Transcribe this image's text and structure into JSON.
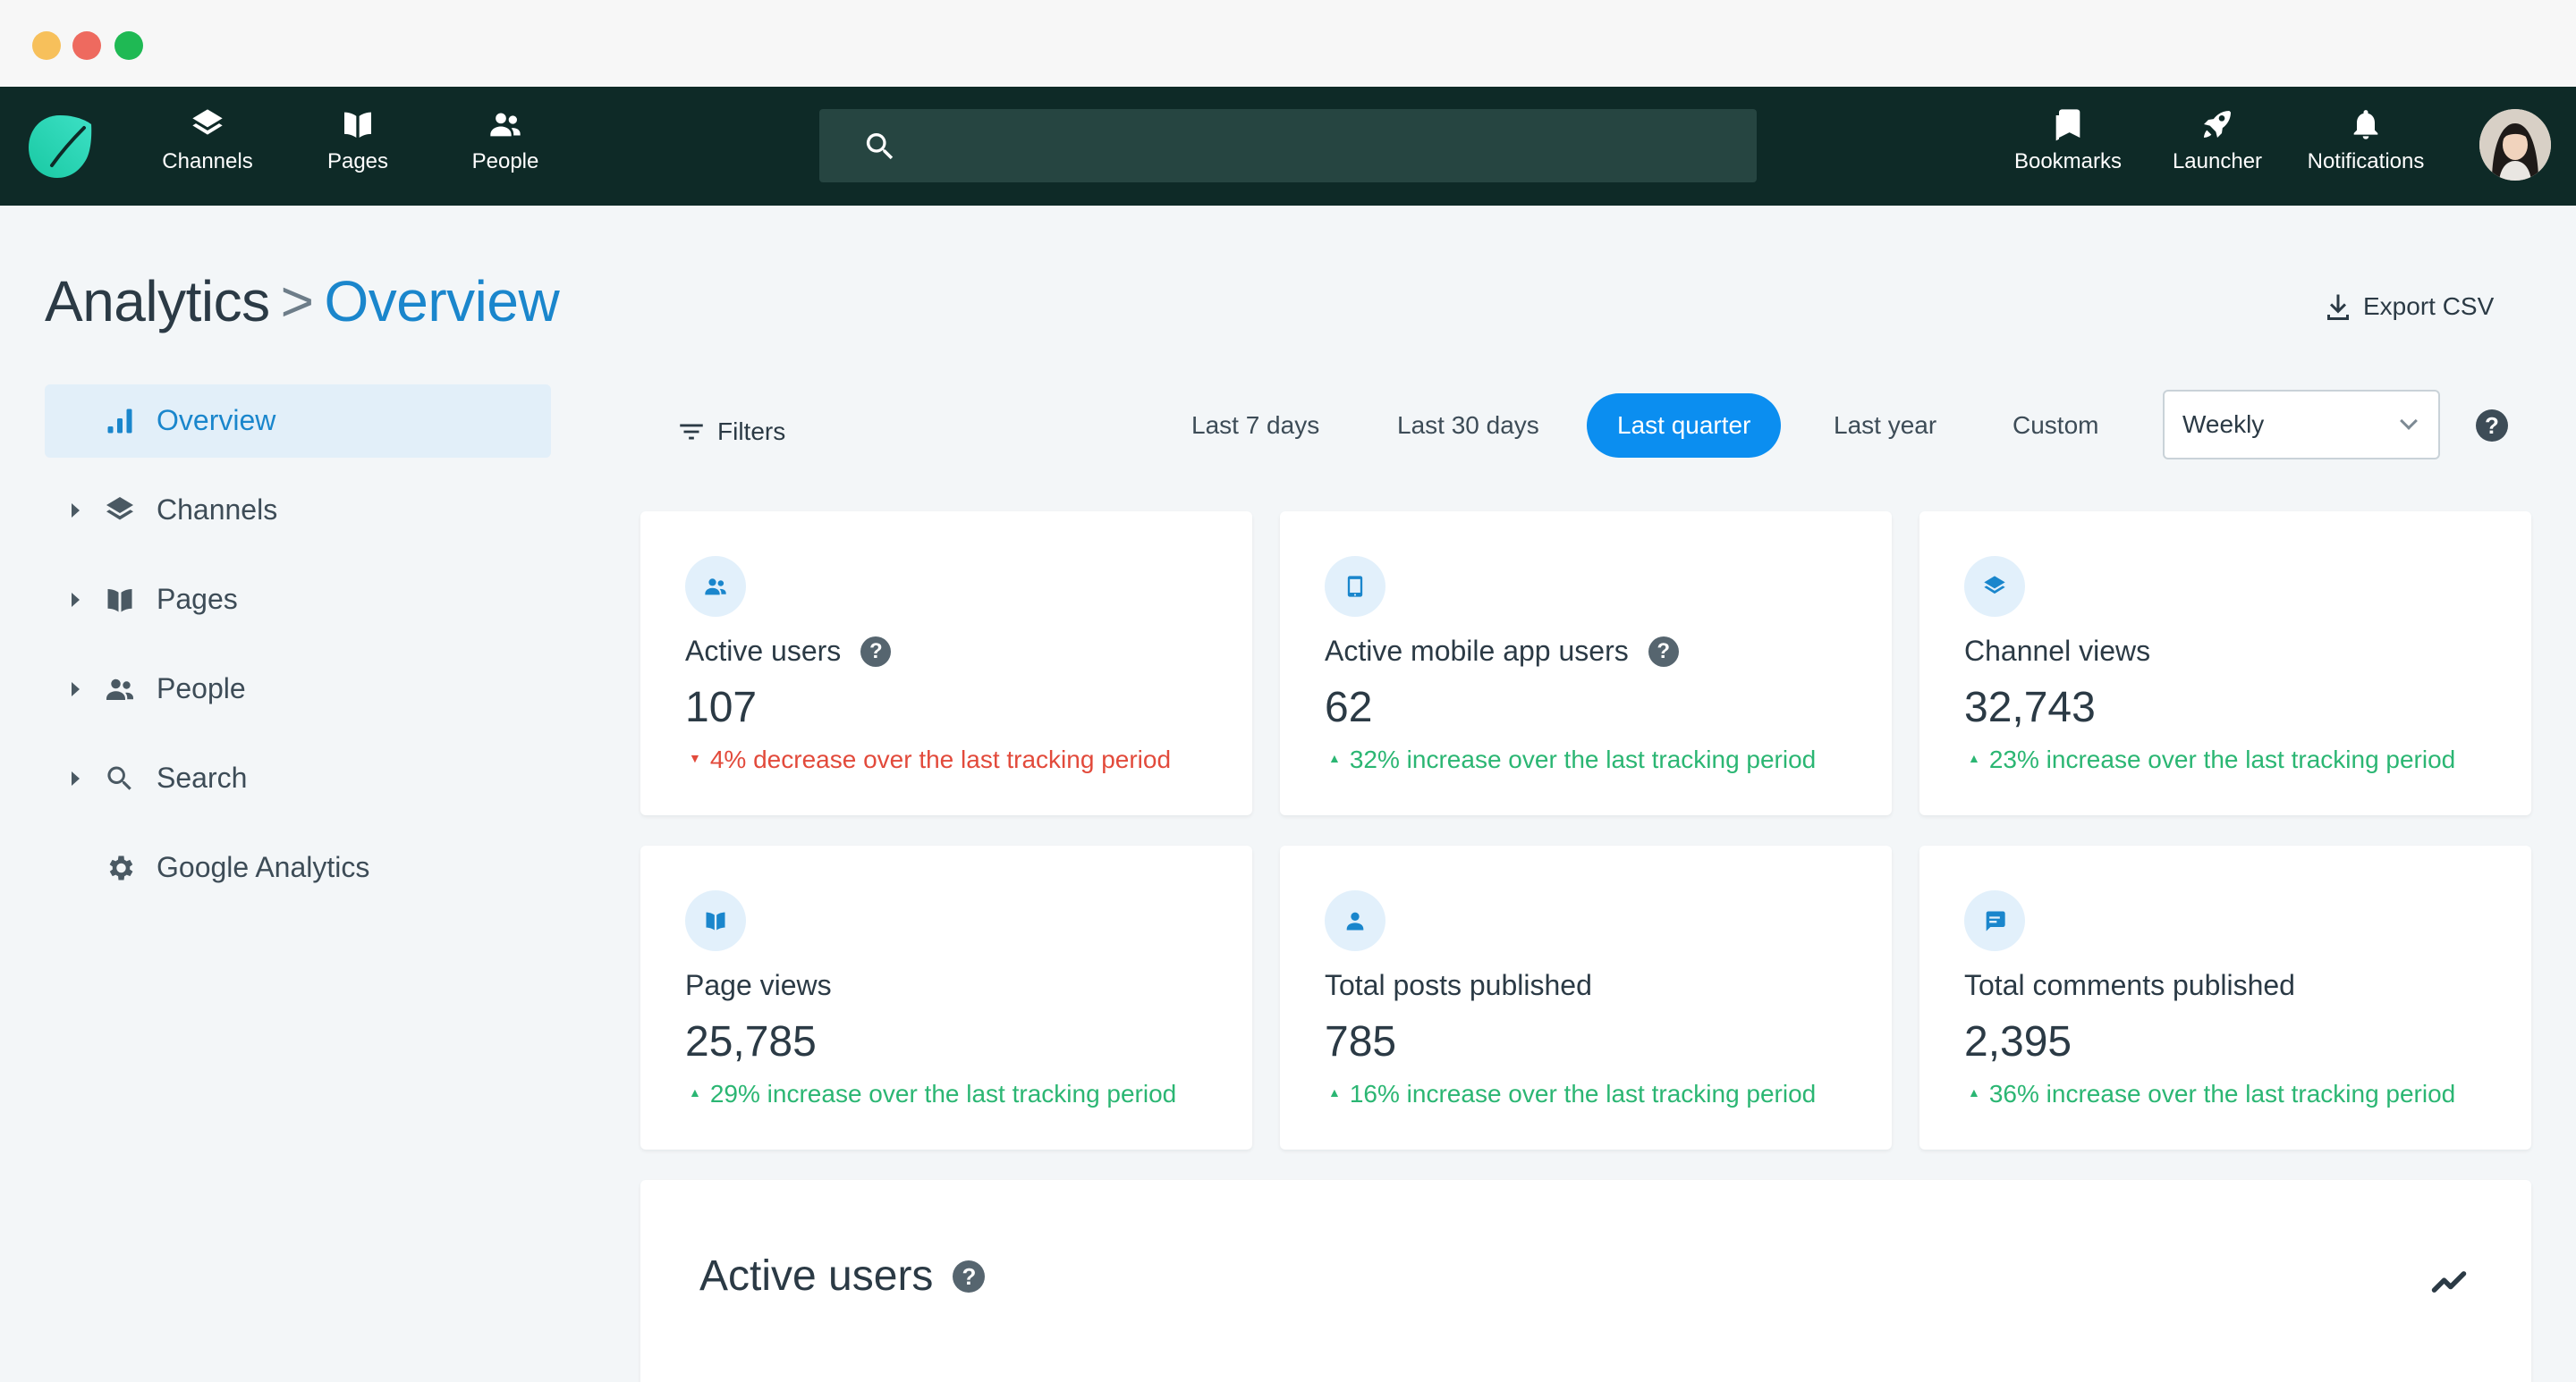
{
  "topnav": {
    "items": [
      {
        "label": "Channels",
        "icon": "layers-icon"
      },
      {
        "label": "Pages",
        "icon": "book-icon"
      },
      {
        "label": "People",
        "icon": "people-icon"
      }
    ],
    "search_placeholder": "",
    "right_items": [
      {
        "label": "Bookmarks",
        "icon": "bookmark-icon"
      },
      {
        "label": "Launcher",
        "icon": "rocket-icon"
      },
      {
        "label": "Notifications",
        "icon": "bell-icon"
      }
    ]
  },
  "header": {
    "root": "Analytics",
    "separator": ">",
    "current": "Overview",
    "export_label": "Export CSV"
  },
  "sidebar": {
    "items": [
      {
        "label": "Overview",
        "icon": "bar-chart-icon",
        "active": true
      },
      {
        "label": "Channels",
        "icon": "layers-icon",
        "expandable": true
      },
      {
        "label": "Pages",
        "icon": "book-icon",
        "expandable": true
      },
      {
        "label": "People",
        "icon": "people-icon",
        "expandable": true
      },
      {
        "label": "Search",
        "icon": "search-icon",
        "expandable": true
      },
      {
        "label": "Google Analytics",
        "icon": "gear-icon"
      }
    ]
  },
  "toolbar": {
    "filters_label": "Filters",
    "ranges": [
      "Last 7 days",
      "Last 30 days",
      "Last quarter",
      "Last year",
      "Custom"
    ],
    "active_range": "Last quarter",
    "interval_value": "Weekly",
    "help": "?"
  },
  "cards": [
    {
      "title": "Active users",
      "value": "107",
      "delta": "4% decrease over the last tracking period",
      "trend": "down",
      "help": "?",
      "icon": "people-icon"
    },
    {
      "title": "Active mobile app users",
      "value": "62",
      "delta": "32% increase over the last tracking period",
      "trend": "up",
      "help": "?",
      "icon": "phone-icon"
    },
    {
      "title": "Channel views",
      "value": "32,743",
      "delta": "23% increase over the last tracking period",
      "trend": "up",
      "icon": "layers-icon"
    },
    {
      "title": "Page views",
      "value": "25,785",
      "delta": "29% increase over the last tracking period",
      "trend": "up",
      "icon": "book-icon"
    },
    {
      "title": "Total posts published",
      "value": "785",
      "delta": "16% increase over the last tracking period",
      "trend": "up",
      "icon": "person-icon"
    },
    {
      "title": "Total comments published",
      "value": "2,395",
      "delta": "36% increase over the last tracking period",
      "trend": "up",
      "icon": "comment-icon"
    }
  ],
  "panel": {
    "title": "Active users",
    "help": "?",
    "icon": "trend-line-icon"
  },
  "colors": {
    "nav_bg": "#0e2a27",
    "accent": "#0b8ef0",
    "link": "#1a86cc",
    "increase": "#2bb673",
    "decrease": "#e24a3b"
  }
}
